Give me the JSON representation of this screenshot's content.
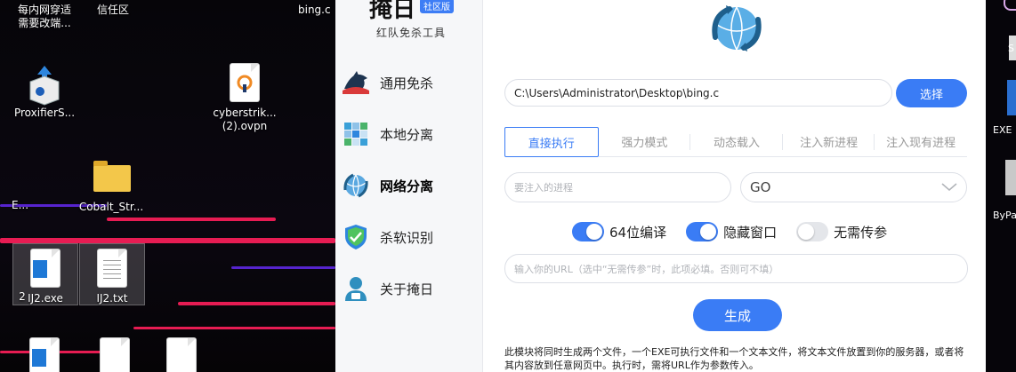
{
  "desktop": {
    "icons": [
      {
        "label": "每内网穿适\n需要改端..."
      },
      {
        "label": "信任区"
      },
      {
        "label": "bing.c"
      },
      {
        "label": "ProxifierS..."
      },
      {
        "label": "cyberstrik...\n(2).ovpn"
      },
      {
        "label": "Cobalt_Str..."
      },
      {
        "label": "E..."
      },
      {
        "label": "IJ2.exe"
      },
      {
        "label": "IJ2.txt"
      },
      {
        "label": "2"
      }
    ]
  },
  "app": {
    "brand": "掩日",
    "edition_badge": "社区版",
    "subtitle": "红队免杀工具",
    "nav": [
      {
        "label": "通用免杀",
        "icon": "shark-icon"
      },
      {
        "label": "本地分离",
        "icon": "grid-icon"
      },
      {
        "label": "网络分离",
        "icon": "globe-icon",
        "active": true
      },
      {
        "label": "杀软识别",
        "icon": "shield-check-icon"
      },
      {
        "label": "关于掩日",
        "icon": "user-icon"
      }
    ],
    "file_path": "C:\\Users\\Administrator\\Desktop\\bing.c",
    "select_button": "选择",
    "tabs": [
      "直接执行",
      "强力模式",
      "动态载入",
      "注入新进程",
      "注入现有进程"
    ],
    "active_tab": 0,
    "process_placeholder": "要注入的进程",
    "language_select": "GO",
    "toggles": [
      {
        "label": "64位编译",
        "on": true
      },
      {
        "label": "隐藏窗口",
        "on": true
      },
      {
        "label": "无需传参",
        "on": false
      }
    ],
    "url_placeholder": "输入你的URL（选中“无需传参”时，此项必填。否则可不填）",
    "generate_button": "生成",
    "description": "此模块将同时生成两个文件，一个EXE可执行文件和一个文本文件，将文本文件放置到你的服务器，或者将其内容放到任意网页中。执行时，需将URL作为参数传入。",
    "accent": "#3a7cf5"
  },
  "right_strip": {
    "texts": [
      "S",
      "EXE",
      "ByPa"
    ]
  }
}
